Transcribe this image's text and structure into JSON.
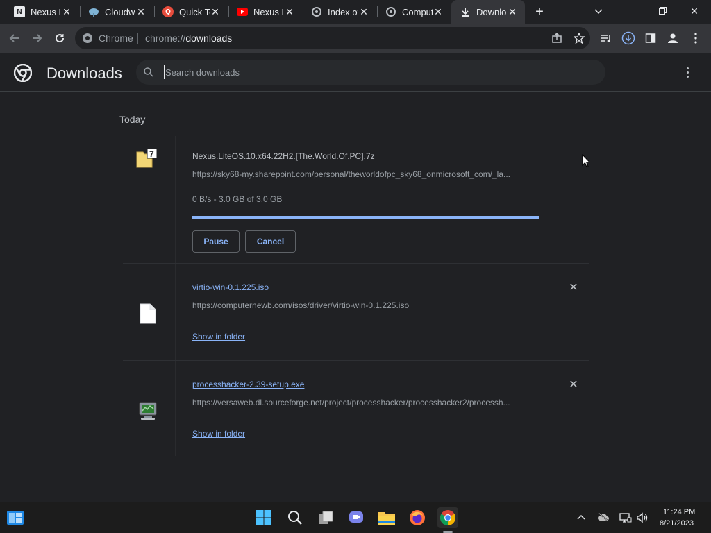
{
  "tabs": [
    {
      "title": "Nexus Li",
      "icon": "nexus-favicon"
    },
    {
      "title": "Cloudwa",
      "icon": "cloud-favicon"
    },
    {
      "title": "Quick Te",
      "icon": "quick-favicon"
    },
    {
      "title": "Nexus L",
      "icon": "youtube-favicon"
    },
    {
      "title": "Index of",
      "icon": "index-favicon"
    },
    {
      "title": "Comput",
      "icon": "computernewb-favicon"
    },
    {
      "title": "Downlo",
      "icon": "download-favicon",
      "active": true
    }
  ],
  "omnibox": {
    "site_label": "Chrome",
    "url_scheme": "chrome://",
    "url_path": "downloads"
  },
  "header": {
    "title": "Downloads",
    "search_placeholder": "Search downloads"
  },
  "date_heading": "Today",
  "downloads": [
    {
      "filename": "Nexus.LiteOS.10.x64.22H2.[The.World.Of.PC].7z",
      "url": "https://sky68-my.sharepoint.com/personal/theworldofpc_sky68_onmicrosoft_com/_la...",
      "status": "0 B/s - 3.0 GB of 3.0 GB",
      "progress": 1.0,
      "pause_label": "Pause",
      "cancel_label": "Cancel"
    },
    {
      "filename": "virtio-win-0.1.225.iso",
      "url": "https://computernewb.com/isos/driver/virtio-win-0.1.225.iso",
      "action_label": "Show in folder"
    },
    {
      "filename": "processhacker-2.39-setup.exe",
      "url": "https://versaweb.dl.sourceforge.net/project/processhacker/processhacker2/processh...",
      "action_label": "Show in folder"
    }
  ],
  "taskbar": {
    "time": "11:24 PM",
    "date": "8/21/2023"
  },
  "colors": {
    "accent": "#8ab4f8",
    "background": "#202124",
    "toolbar": "#35363a"
  }
}
